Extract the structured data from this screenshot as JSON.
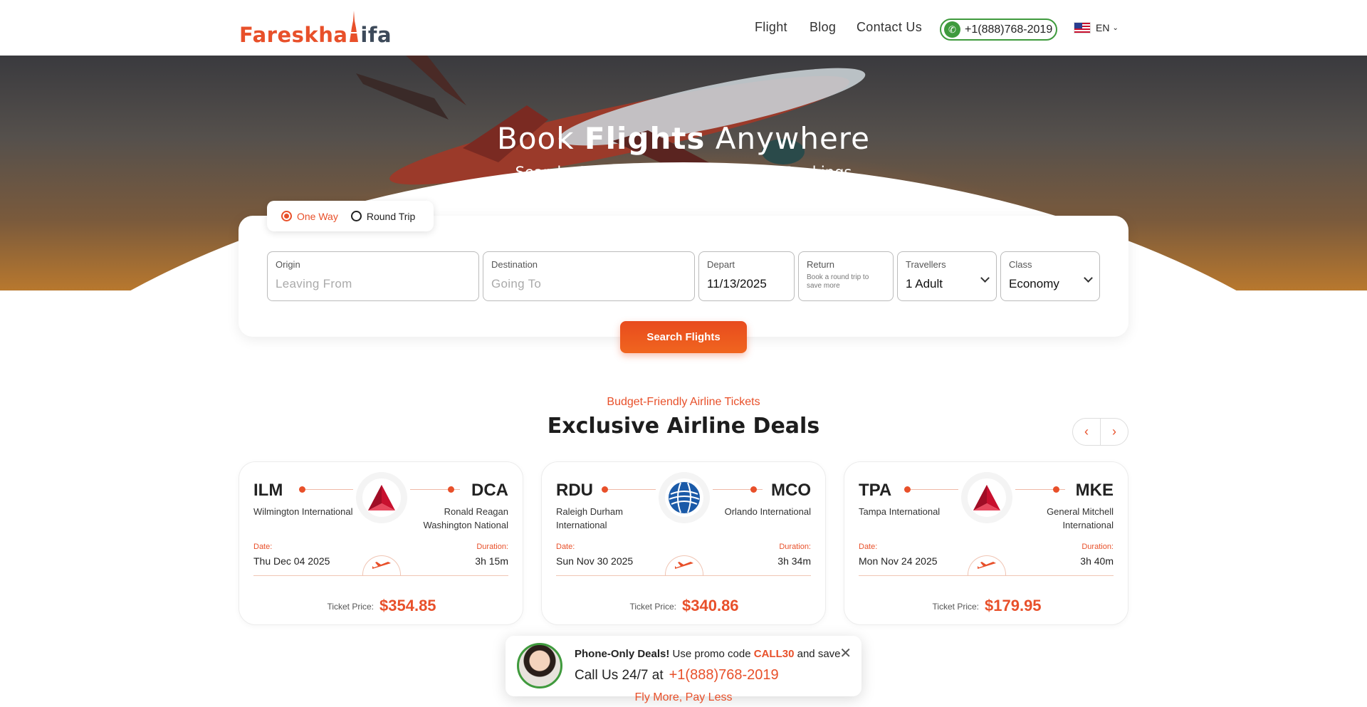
{
  "header": {
    "logo": {
      "part1": "Fareskha",
      "part2": "ifa"
    },
    "nav": [
      "Flight",
      "Blog",
      "Contact Us"
    ],
    "phone": "+1(888)768-2019",
    "language": "EN"
  },
  "hero": {
    "title_pre": "Book",
    "title_bold": "Flights",
    "title_post": "Anywhere",
    "subtitle_pre": "Search, Compare & Save on",
    "subtitle_bold": "Flight",
    "subtitle_post": "Bookings"
  },
  "search": {
    "trip_types": [
      "One Way",
      "Round Trip"
    ],
    "selected_trip": "One Way",
    "origin": {
      "label": "Origin",
      "placeholder": "Leaving From"
    },
    "destination": {
      "label": "Destination",
      "placeholder": "Going To"
    },
    "depart": {
      "label": "Depart",
      "value": "11/13/2025"
    },
    "return": {
      "label": "Return",
      "hint": "Book a round trip to save more"
    },
    "travellers": {
      "label": "Travellers",
      "value": "1 Adult"
    },
    "class": {
      "label": "Class",
      "value": "Economy"
    },
    "button": "Search Flights"
  },
  "deals": {
    "tagline": "Budget-Friendly Airline Tickets",
    "title": "Exclusive Airline Deals",
    "prev": "‹",
    "next": "›",
    "items": [
      {
        "from_code": "ILM",
        "to_code": "DCA",
        "from_city": "Wilmington International",
        "to_city": "Ronald Reagan Washington National",
        "date_label": "Date:",
        "date": "Thu Dec 04 2025",
        "duration_label": "Duration:",
        "duration": "3h 15m",
        "price_label": "Ticket Price:",
        "price": "$354.85",
        "airline_icon": "delta-logo"
      },
      {
        "from_code": "RDU",
        "to_code": "MCO",
        "from_city": "Raleigh Durham International",
        "to_city": "Orlando International",
        "date_label": "Date:",
        "date": "Sun Nov 30 2025",
        "duration_label": "Duration:",
        "duration": "3h 34m",
        "price_label": "Ticket Price:",
        "price": "$340.86",
        "airline_icon": "united-globe-logo"
      },
      {
        "from_code": "TPA",
        "to_code": "MKE",
        "from_city": "Tampa International",
        "to_city": "General Mitchell International",
        "date_label": "Date:",
        "date": "Mon Nov 24 2025",
        "duration_label": "Duration:",
        "duration": "3h 40m",
        "price_label": "Ticket Price:",
        "price": "$179.95",
        "airline_icon": "delta-logo"
      }
    ]
  },
  "promo": {
    "headline": "Phone-Only Deals!",
    "text_pre": "Use promo code",
    "code": "CALL30",
    "text_post": "and save",
    "call_text": "Call Us 24/7 at",
    "phone": "+1(888)768-2019",
    "close": "✕"
  },
  "footer_tagline": "Fly More, Pay Less",
  "colors": {
    "accent": "#e8502a",
    "green": "#3f9a3d"
  }
}
